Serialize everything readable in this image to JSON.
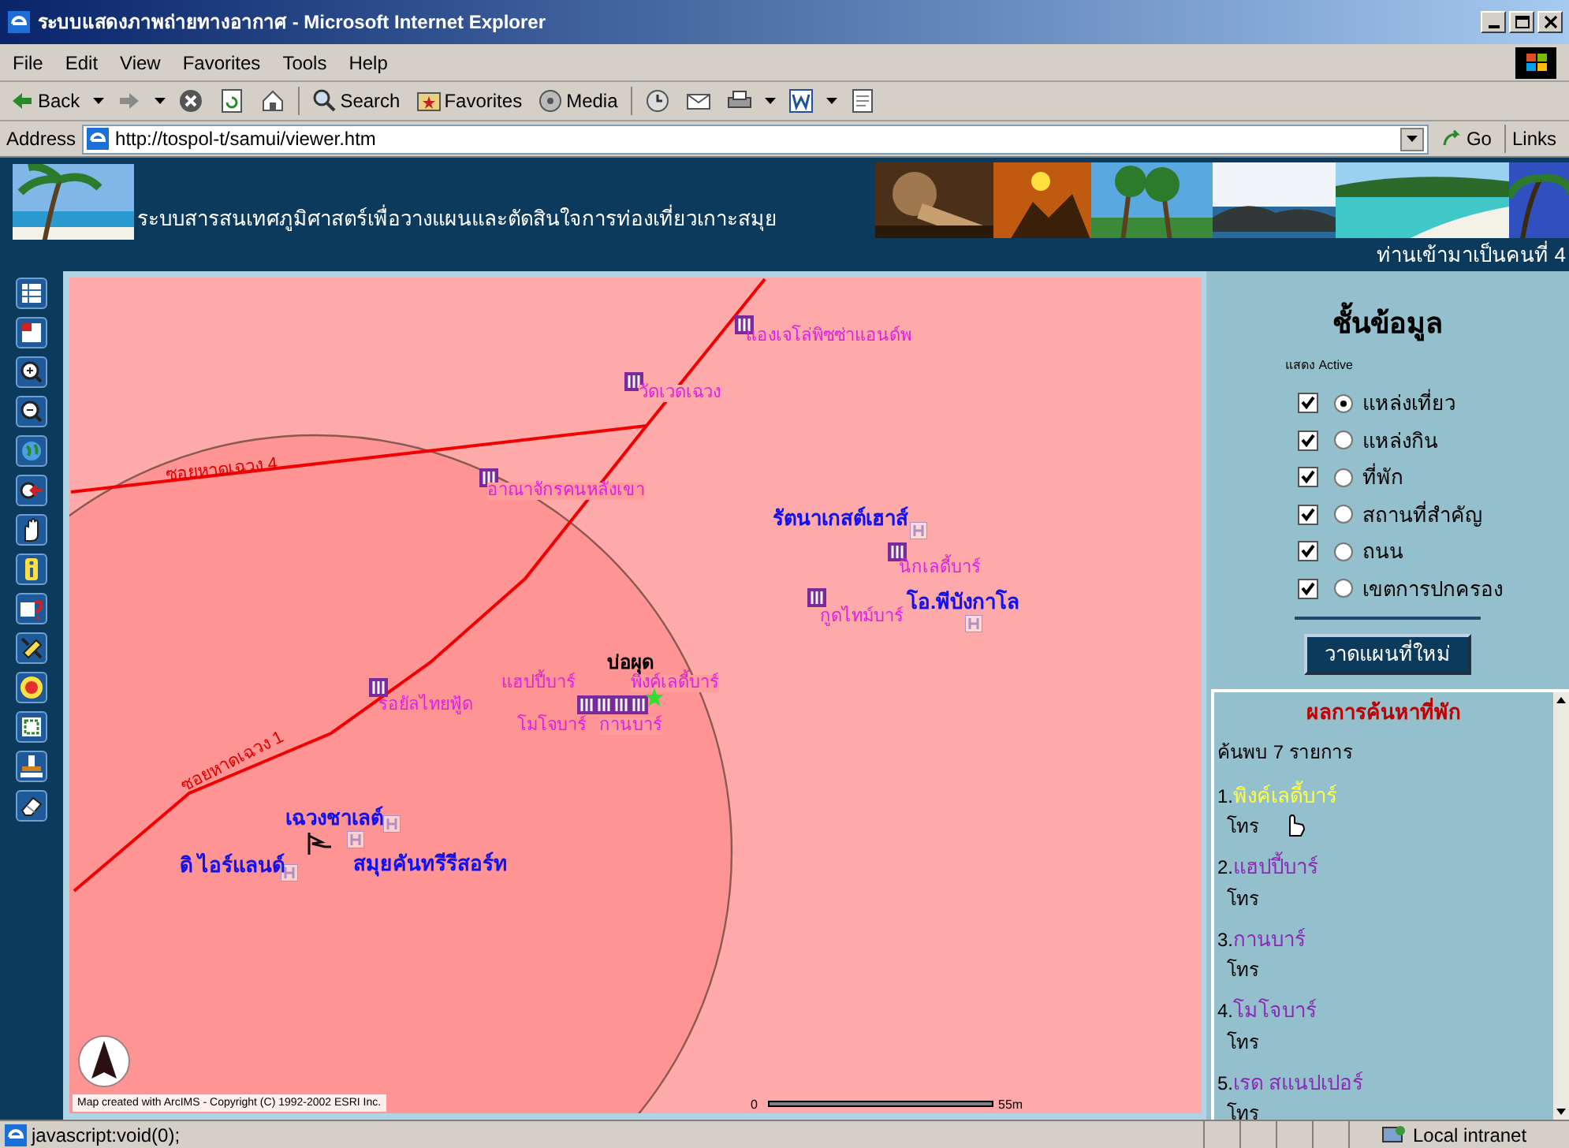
{
  "window": {
    "title": "ระบบแสดงภาพถ่ายทางอากาศ - Microsoft Internet Explorer"
  },
  "menu": [
    "File",
    "Edit",
    "View",
    "Favorites",
    "Tools",
    "Help"
  ],
  "toolbar": [
    {
      "kind": "back",
      "label": "Back"
    },
    {
      "kind": "forward"
    },
    {
      "kind": "stop"
    },
    {
      "kind": "refresh"
    },
    {
      "kind": "home"
    },
    {
      "kind": "search",
      "label": "Search"
    },
    {
      "kind": "favorites",
      "label": "Favorites"
    },
    {
      "kind": "media",
      "label": "Media"
    },
    {
      "kind": "history"
    },
    {
      "kind": "mail"
    },
    {
      "kind": "print"
    },
    {
      "kind": "edit"
    },
    {
      "kind": "discuss"
    }
  ],
  "address": {
    "label": "Address",
    "url": "http://tospol-t/samui/viewer.htm",
    "go": "Go",
    "links": "Links"
  },
  "banner": {
    "title": "ระบบสารสนเทศภูมิศาสตร์เพื่อวางแผนและตัดสินใจการท่องเที่ยวเกาะสมุย",
    "visitor": "ท่านเข้ามาเป็นคนที่ 4"
  },
  "map": {
    "roads": [
      {
        "label": "ซอยหาดเฉวง 4"
      },
      {
        "label": "ซอยหาดเฉวง 1"
      }
    ],
    "places": [
      {
        "kind": "restaurant",
        "label": "แองเจโล่พิซซ่าแอนด์พ"
      },
      {
        "kind": "restaurant",
        "label": "วัดเวดเฉวง"
      },
      {
        "kind": "restaurant",
        "label": "อาณาจักรคนหลังเขา"
      },
      {
        "kind": "restaurant",
        "label": "รอยัลไทยฟู้ด"
      },
      {
        "kind": "restaurant",
        "label": "นิกเลดี้บาร์"
      },
      {
        "kind": "restaurant",
        "label": "กูดไทม์บาร์"
      },
      {
        "kind": "restaurant",
        "label": "แฮปปี้บาร์"
      },
      {
        "kind": "restaurant",
        "label": "พิงค์เลดี้บาร์"
      },
      {
        "kind": "restaurant",
        "label": "โมโจบาร์"
      },
      {
        "kind": "restaurant",
        "label": "กานบาร์"
      },
      {
        "kind": "hotel",
        "label": "รัตนาเกสต์เฮาส์"
      },
      {
        "kind": "hotel",
        "label": "โอ.พีบังกาโล"
      },
      {
        "kind": "hotel",
        "label": "เฉวงชาเลต์"
      },
      {
        "kind": "hotel",
        "label": "ดิ ไอร์แลนด์"
      },
      {
        "kind": "hotel",
        "label": "สมุยคันทรีรีสอร์ท"
      },
      {
        "kind": "landmark",
        "label": "บ่อผุด"
      }
    ],
    "copyright": "Map created with ArcIMS - Copyright (C) 1992-2002 ESRI Inc.",
    "scale": {
      "start": "0",
      "end": "55m"
    }
  },
  "layers": {
    "title": "ชั้นข้อมูล",
    "caption": "แสดง Active",
    "items": [
      {
        "label": "แหล่งเที่ยว",
        "visible": true,
        "selected": true
      },
      {
        "label": "แหล่งกิน",
        "visible": true,
        "selected": false
      },
      {
        "label": "ที่พัก",
        "visible": true,
        "selected": false
      },
      {
        "label": "สถานที่สำคัญ",
        "visible": true,
        "selected": false
      },
      {
        "label": "ถนน",
        "visible": true,
        "selected": false
      },
      {
        "label": "เขตการปกครอง",
        "visible": true,
        "selected": false
      }
    ],
    "button": "วาดแผนที่ใหม่"
  },
  "results": {
    "title": "ผลการค้นหาที่พัก",
    "count": "ค้นพบ 7 รายการ",
    "items": [
      {
        "number": "1.",
        "name": "พิงค์เลดี้บาร์",
        "phone": "โทร",
        "highlighted": true
      },
      {
        "number": "2.",
        "name": "แฮปปี้บาร์",
        "phone": "โทร",
        "highlighted": false
      },
      {
        "number": "3.",
        "name": "กานบาร์",
        "phone": "โทร",
        "highlighted": false
      },
      {
        "number": "4.",
        "name": "โมโจบาร์",
        "phone": "โทร",
        "highlighted": false
      },
      {
        "number": "5.",
        "name": "เรด สแนปเปอร์",
        "phone": "โทร",
        "highlighted": false
      }
    ]
  },
  "status_bar": {
    "text": "javascript:void(0);",
    "zone": "Local intranet"
  }
}
